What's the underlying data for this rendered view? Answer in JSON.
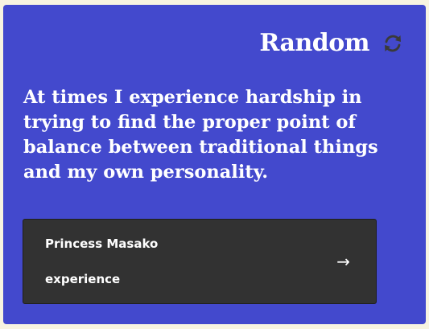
{
  "header": {
    "title": "Random",
    "refresh_icon": "refresh-icon"
  },
  "quote": {
    "text": "At times I experience hardship in trying to find the proper point of balance between traditional things and my own personality."
  },
  "source": {
    "author": "Princess Masako",
    "tag": "experience",
    "arrow": "→",
    "arrow_icon": "arrow-right-icon"
  },
  "colors": {
    "page_background": "#f8f4e1",
    "card_background": "#4349cd",
    "source_background": "#323232",
    "text": "#ffffff",
    "icon": "#3a3a3a"
  }
}
